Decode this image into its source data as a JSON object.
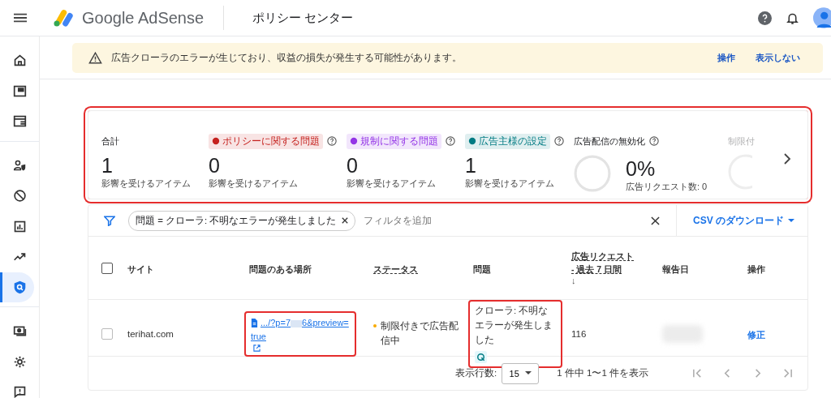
{
  "header": {
    "product": "Google AdSense",
    "page_title": "ポリシー センター"
  },
  "sidebar": {
    "groups": [
      [
        {
          "selected": false
        },
        {
          "selected": false
        },
        {
          "selected": false
        }
      ],
      [
        {
          "selected": false
        },
        {
          "selected": false
        },
        {
          "selected": false
        },
        {
          "selected": false
        },
        {
          "selected": true
        }
      ],
      [
        {
          "selected": false
        },
        {
          "selected": false
        },
        {
          "selected": false
        }
      ]
    ]
  },
  "banner": {
    "message": "広告クローラのエラーが生じており、収益の損失が発生する可能性があります。",
    "actions": [
      "操作",
      "表示しない"
    ]
  },
  "stats": {
    "highlighted": true,
    "items": [
      {
        "kind": "total",
        "label": "合計",
        "value": "1",
        "caption": "影響を受けるアイテム"
      },
      {
        "kind": "chip",
        "label": "ポリシーに関する問題",
        "color": "#c5221f",
        "value": "0",
        "caption": "影響を受けるアイテム"
      },
      {
        "kind": "chip",
        "label": "規制に関する問題",
        "color": "#9334e6",
        "value": "0",
        "caption": "影響を受けるアイテム"
      },
      {
        "kind": "chip",
        "label": "広告主様の設定",
        "color": "#007b83",
        "value": "1",
        "caption": "影響を受けるアイテム"
      },
      {
        "kind": "ring",
        "label": "広告配信の無効化",
        "value": "0%",
        "caption": "広告リクエスト数: 0"
      },
      {
        "kind": "faded",
        "label": "制限付"
      }
    ]
  },
  "filter": {
    "chip": "問題 = クローラ: 不明なエラーが発生しました",
    "placeholder": "フィルタを追加",
    "download": "CSV のダウンロード"
  },
  "table": {
    "all_checked": false,
    "columns": [
      {
        "label": "サイト",
        "underlined": false
      },
      {
        "label": "問題のある場所",
        "underlined": false
      },
      {
        "label": "ステータス",
        "underlined": true
      },
      {
        "label": "問題",
        "underlined": false
      },
      {
        "label": "広告リクエスト - 過去 7 日間",
        "underlined": true,
        "sort": "↓"
      },
      {
        "label": "報告日",
        "underlined": false
      },
      {
        "label": "操作",
        "underlined": false
      }
    ],
    "rows": [
      {
        "checked": false,
        "site": "terihat.com",
        "location_start": ".../?p=7",
        "location_end": "6&preview=true",
        "location_highlighted": true,
        "status": "制限付きで広告配信中",
        "issue": "クローラ: 不明なエラーが発生しました",
        "issue_highlighted": true,
        "requests": "116",
        "action": "修正"
      }
    ]
  },
  "pagination": {
    "rows_label": "表示行数:",
    "rows_value": "15",
    "range": "1 件中 1〜1 件を表示"
  }
}
